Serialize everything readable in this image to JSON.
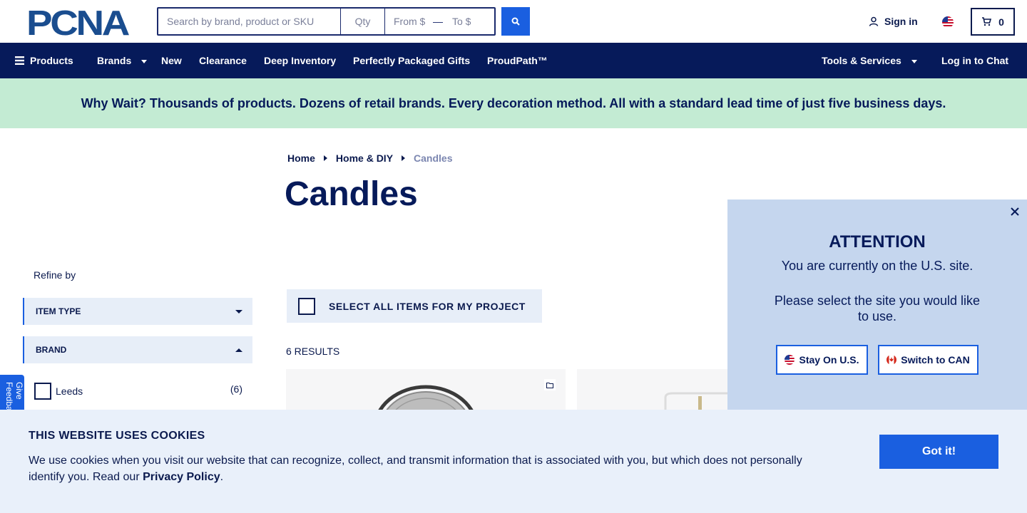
{
  "header": {
    "logo_text": "PCNA",
    "search": {
      "placeholder": "Search by brand, product or SKU",
      "qty_placeholder": "Qty",
      "from_placeholder": "From $",
      "to_placeholder": "To $"
    },
    "sign_in_label": "Sign in",
    "cart_count": "0"
  },
  "nav": {
    "items": [
      {
        "label": "Products"
      },
      {
        "label": "Brands"
      },
      {
        "label": "New"
      },
      {
        "label": "Clearance"
      },
      {
        "label": "Deep Inventory"
      },
      {
        "label": "Perfectly Packaged Gifts"
      },
      {
        "label": "ProudPath™"
      }
    ],
    "right": [
      {
        "label": "Tools & Services"
      },
      {
        "label": "Log in to Chat"
      }
    ]
  },
  "banner": {
    "text": "Why Wait? Thousands of products. Dozens of retail brands. Every decoration method. All with a standard lead time of just five business days."
  },
  "breadcrumb": [
    "Home",
    "Home & DIY",
    "Candles"
  ],
  "page_title": "Candles",
  "sidebar": {
    "refine_label": "Refine by",
    "facets": [
      {
        "label": "ITEM TYPE",
        "expanded": false
      },
      {
        "label": "BRAND",
        "expanded": true
      }
    ],
    "brand_options": [
      {
        "label": "Leeds",
        "count": "(6)"
      }
    ],
    "feedback_label": "Give Feedback"
  },
  "main": {
    "select_all_label": "SELECT ALL ITEMS FOR MY PROJECT",
    "results_label": "6 RESULTS"
  },
  "popup": {
    "title": "ATTENTION",
    "line1": "You are currently on the U.S. site.",
    "line2": "Please select the site you would like to use.",
    "stay_label": "Stay On U.S.",
    "switch_label": "Switch to CAN"
  },
  "cookie": {
    "title": "THIS WEBSITE USES COOKIES",
    "text": "We use cookies when you visit our website that can recognize, collect, and transmit information that is associated with you, but which does not personally identify you. Read our ",
    "link": "Privacy Policy",
    "suffix": ".",
    "button_label": "Got it!"
  },
  "colors": {
    "navy": "#061a5a",
    "accent_blue": "#1a5fe0",
    "banner_green": "#c3ebd3",
    "popup_bg": "#c5d6ee",
    "cookie_bg": "#e9f0fa"
  }
}
